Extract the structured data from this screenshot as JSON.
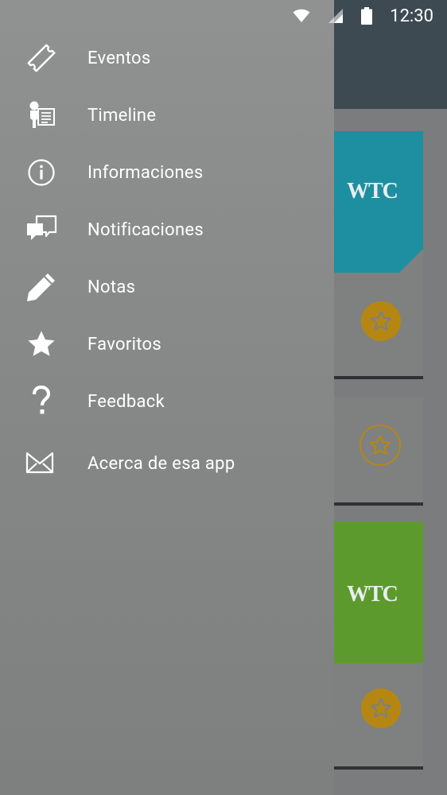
{
  "status_bar": {
    "time": "12:30",
    "icons": [
      "wifi-icon",
      "cell-signal-icon",
      "battery-icon"
    ]
  },
  "drawer": {
    "items": [
      {
        "label": "Eventos",
        "icon": "ticket-icon"
      },
      {
        "label": "Timeline",
        "icon": "speaker-document-icon"
      },
      {
        "label": "Informaciones",
        "icon": "info-icon"
      },
      {
        "label": "Notificaciones",
        "icon": "chat-bubbles-icon"
      },
      {
        "label": "Notas",
        "icon": "pencil-icon"
      },
      {
        "label": "Favoritos",
        "icon": "star-icon"
      },
      {
        "label": "Feedback",
        "icon": "question-icon"
      },
      {
        "label": "Acerca de esa app",
        "icon": "envelope-icon"
      }
    ]
  },
  "background": {
    "cards": [
      {
        "logo": "WTC",
        "image_color": "teal",
        "favorite": true
      },
      {
        "logo": "",
        "favorite": false
      },
      {
        "logo": "WTC",
        "image_color": "green",
        "favorite": true
      }
    ]
  },
  "colors": {
    "drawer": "#8a8c8c",
    "toolbar": "#3e4a52",
    "accent_gold": "#b58712",
    "card_teal": "#1e8fa0",
    "card_green": "#5d9a2e"
  }
}
